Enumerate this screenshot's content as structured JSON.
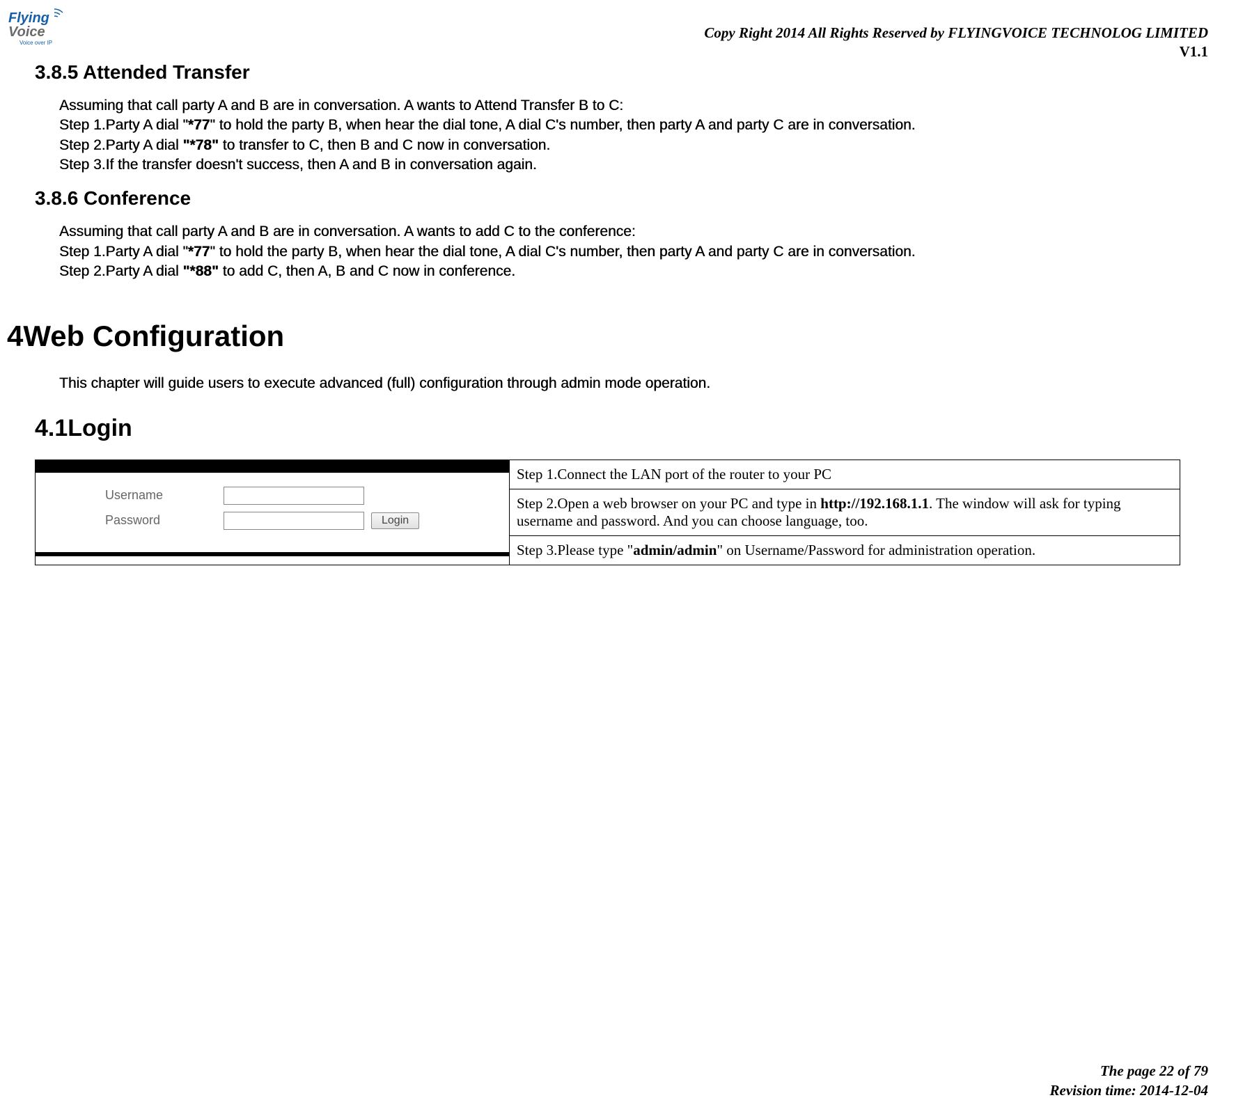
{
  "header": {
    "logo_brand_top": "Flying",
    "logo_brand_bottom": "Voice",
    "logo_tagline": "Voice over IP",
    "copyright": "Copy Right 2014 All Rights Reserved by FLYINGVOICE TECHNOLOG LIMITED",
    "version": "V1.1"
  },
  "section_385": {
    "title": "3.8.5 Attended Transfer",
    "intro": "Assuming that call party A and B are in conversation. A wants to Attend Transfer B to C:",
    "step1_a": "Step 1.Party A dial \"",
    "step1_code": "*77",
    "step1_b": "\" to hold the party B, when hear the dial tone, A dial C's number, then party A and party C are in conversation.",
    "step2_a": "Step 2.Party A dial ",
    "step2_code": "\"*78\"",
    "step2_b": " to transfer to C, then B and C now in conversation.",
    "step3": "Step 3.If the transfer doesn't success, then A and B in conversation again."
  },
  "section_386": {
    "title": "3.8.6 Conference",
    "intro": "Assuming that call party A and B are in conversation. A wants to add C to the conference:",
    "step1_a": "Step 1.Party A dial \"",
    "step1_code": "*77",
    "step1_b": "\" to hold the party B, when hear the dial tone, A dial C's number, then party A and party C are in conversation.",
    "step2_a": "Step 2.Party A dial ",
    "step2_code": "\"*88\"",
    "step2_b": " to add C, then A, B and C now in conference."
  },
  "chapter": {
    "title": "4Web Configuration",
    "intro": "This chapter will guide users to execute advanced (full) configuration through admin mode operation."
  },
  "section_41": {
    "title": "4.1Login",
    "form": {
      "username_label": "Username",
      "password_label": "Password",
      "login_button": "Login"
    },
    "steps": {
      "s1": "Step 1.Connect the LAN port of the router to your PC",
      "s2_a": "Step 2.Open a web browser on your PC and type in ",
      "s2_url": "http://192.168.1.1",
      "s2_b": ". The window will ask for typing username and password. And you can choose language, too.",
      "s3_a": "Step 3.Please type \"",
      "s3_cred": "admin/admin",
      "s3_b": "\" on Username/Password for administration operation."
    }
  },
  "footer": {
    "page": "The page 22 of 79",
    "revision": "Revision time: 2014-12-04"
  }
}
